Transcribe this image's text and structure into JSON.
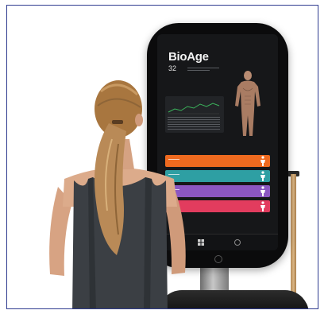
{
  "screen": {
    "header": "",
    "title": "BioAge",
    "value": "32",
    "metrics_label": "",
    "metrics": [
      {
        "color": "#ef6a1f"
      },
      {
        "color": "#2e9fa3"
      },
      {
        "color": "#8b57c2"
      },
      {
        "color": "#e23c5e"
      }
    ]
  },
  "colors": {
    "device": "#0b0b0c",
    "screen": "#161719",
    "top_tank": "#3b3f44",
    "hair": "#b98a57",
    "pole": "#c79c68"
  }
}
